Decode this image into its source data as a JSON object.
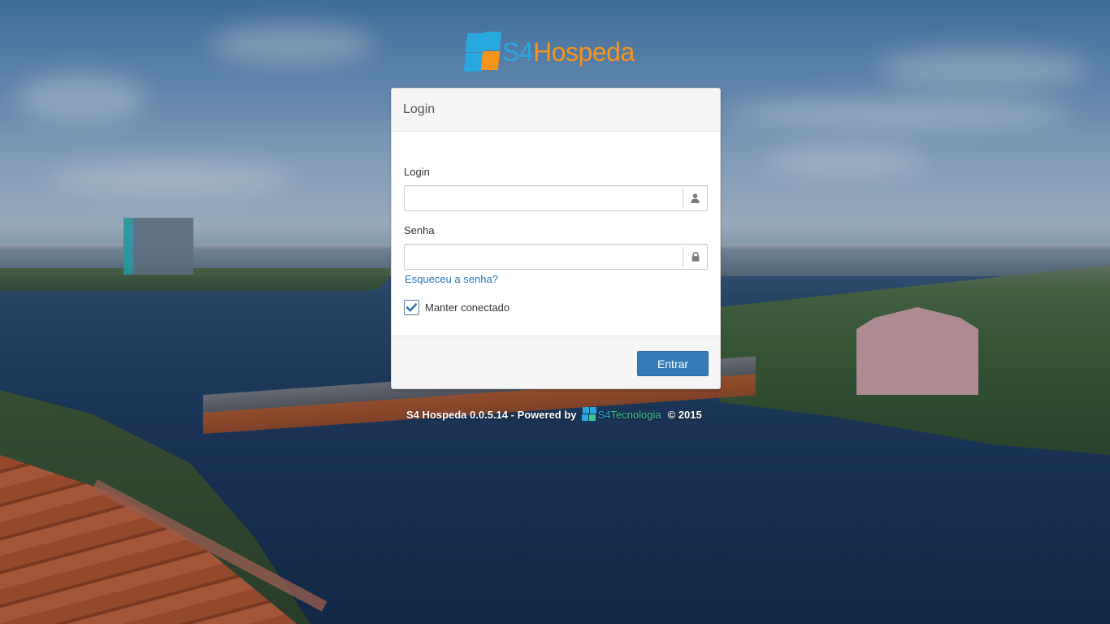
{
  "brand": {
    "prefix": "S4",
    "name": "Hospeda"
  },
  "panel": {
    "title": "Login"
  },
  "form": {
    "login_label": "Login",
    "login_value": "",
    "login_icon": "user-icon",
    "password_label": "Senha",
    "password_value": "",
    "password_icon": "lock-icon",
    "forgot_link": "Esqueceu a senha?",
    "remember_label": "Manter conectado",
    "remember_checked": true,
    "submit_label": "Entrar"
  },
  "footer": {
    "version_text": "S4 Hospeda 0.0.5.14 - Powered by",
    "powered_prefix": "S4",
    "powered_name": "Tecnologia",
    "copyright": "© 2015"
  },
  "colors": {
    "brand_blue": "#29a7df",
    "brand_orange": "#f7941d",
    "primary_button": "#337ab7",
    "link": "#2a7ab8",
    "tecnologia_green": "#3cc48a"
  }
}
